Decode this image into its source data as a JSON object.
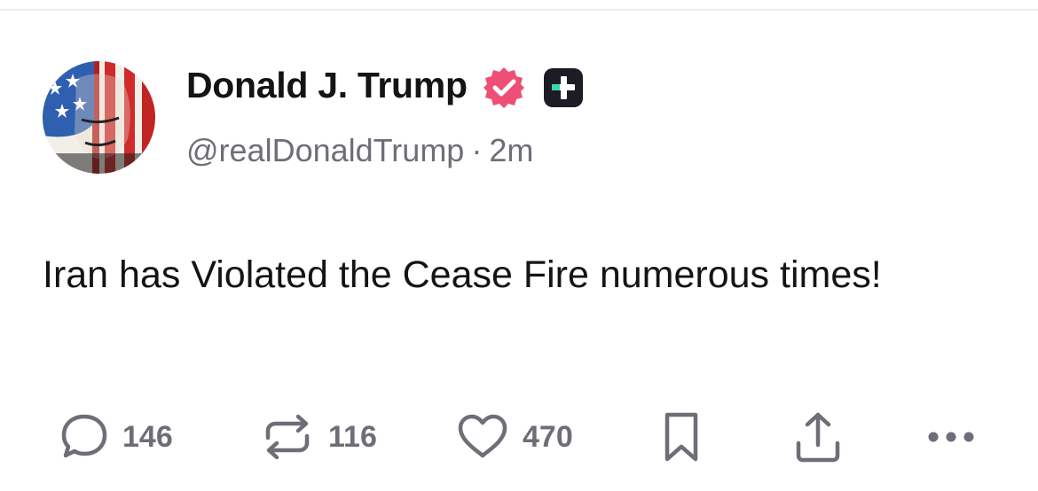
{
  "post": {
    "author": {
      "display_name": "Donald J. Trump",
      "handle": "@realDonaldTrump",
      "verified": true
    },
    "timestamp": "2m",
    "separator": "·",
    "text": "Iran has Violated the Cease Fire numerous times!",
    "actions": {
      "replies": "146",
      "reposts": "116",
      "likes": "470"
    }
  },
  "colors": {
    "verified_badge": "#ee4f76",
    "plus_badge_bg": "#1c1c24",
    "plus_badge_accent": "#3ad6b0",
    "icon_gray": "#6e6e78",
    "text": "#141414"
  },
  "icons": [
    "avatar",
    "verified-badge-icon",
    "plus-badge-icon",
    "reply-icon",
    "repost-icon",
    "like-icon",
    "bookmark-icon",
    "share-icon",
    "more-icon"
  ]
}
